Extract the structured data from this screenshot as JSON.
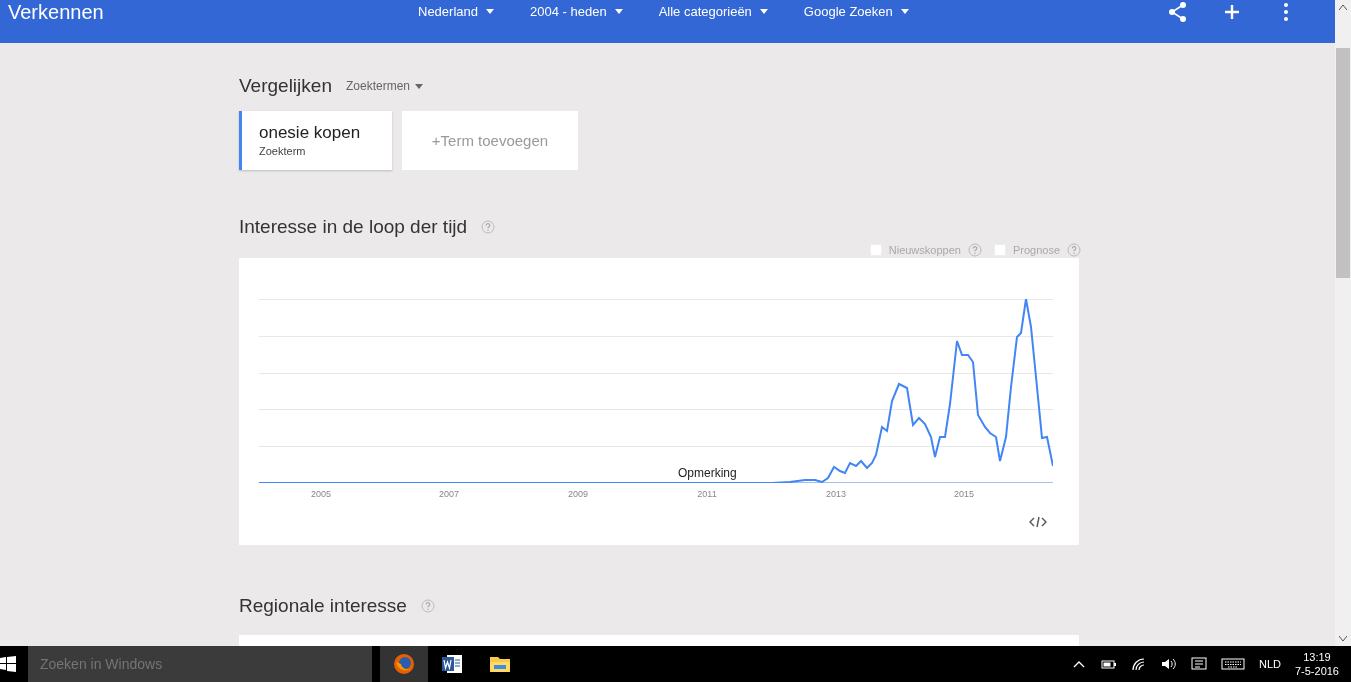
{
  "topbar": {
    "title": "Verkennen",
    "filters": [
      {
        "label": "Nederland"
      },
      {
        "label": "2004 - heden"
      },
      {
        "label": "Alle categorieën"
      },
      {
        "label": "Google Zoeken"
      }
    ]
  },
  "compare": {
    "title": "Vergelijken",
    "mode": "Zoektermen",
    "terms": [
      {
        "term": "onesie kopen",
        "subtitle": "Zoekterm"
      }
    ],
    "add_term": "+Term toevoegen"
  },
  "interest_over_time": {
    "title": "Interesse in de loop der tijd",
    "options": [
      {
        "label": "Nieuwskoppen",
        "checked": false
      },
      {
        "label": "Prognose",
        "checked": false
      }
    ],
    "note": "Opmerking",
    "x_labels": [
      "2005",
      "2007",
      "2009",
      "2011",
      "2013",
      "2015"
    ]
  },
  "regional": {
    "title": "Regionale interesse"
  },
  "taskbar": {
    "search_placeholder": "Zoeken in Windows",
    "language": "NLD",
    "time": "13:19",
    "date": "7-5-2016"
  }
}
